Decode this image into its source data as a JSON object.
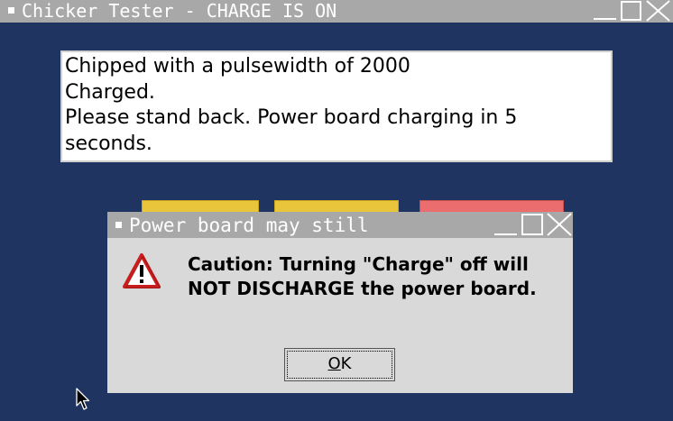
{
  "window": {
    "title": "Chicker Tester - CHARGE IS ON"
  },
  "log": {
    "lines": [
      "Chipped with a pulsewidth of 2000",
      "Charged.",
      "Please stand back. Power board charging in 5",
      "seconds."
    ]
  },
  "dialog": {
    "title": "Power board may still",
    "icon": "warning-icon",
    "message_lines": [
      "Caution: Turning \"Charge\" off will",
      "NOT DISCHARGE the power board."
    ],
    "ok_label_first": "O",
    "ok_label_rest": "K"
  },
  "colors": {
    "background": "#1f3461",
    "titlebar": "#a8a8a8",
    "button_yellow": "#e8c53a",
    "button_red": "#ec6d6d"
  }
}
